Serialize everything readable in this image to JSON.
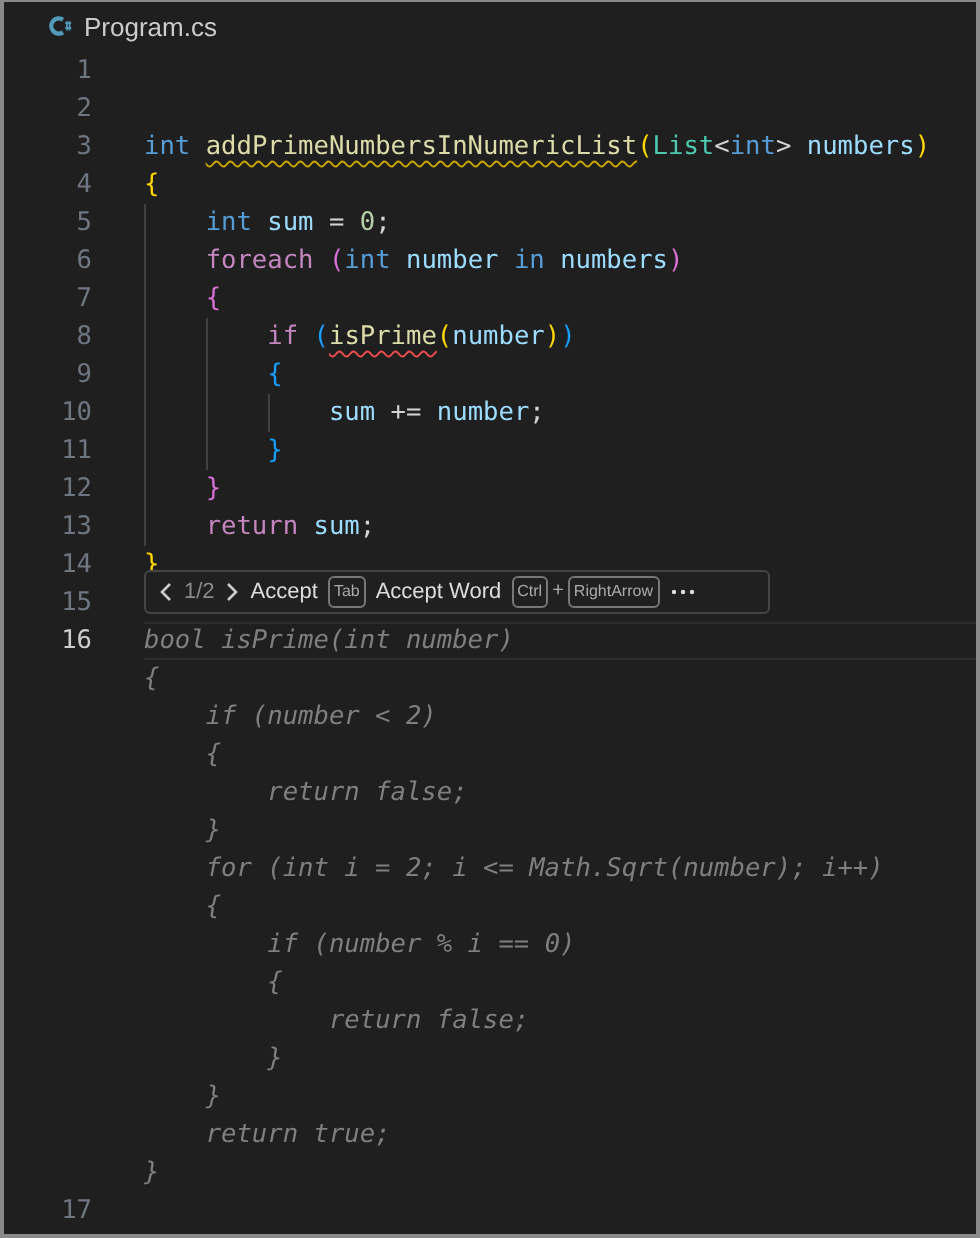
{
  "tab": {
    "title": "Program.cs"
  },
  "lines": [
    {
      "number": "1",
      "current": false
    },
    {
      "number": "2",
      "current": false
    },
    {
      "number": "3",
      "current": false,
      "tokens": [
        {
          "text": "int ",
          "kind": "keyword"
        },
        {
          "text": "addPrimeNumbersInNumericList",
          "kind": "function",
          "warning": true
        },
        {
          "text": "(",
          "kind": "bracket1"
        },
        {
          "text": "List",
          "kind": "type"
        },
        {
          "text": "<",
          "kind": "punct"
        },
        {
          "text": "int",
          "kind": "keyword"
        },
        {
          "text": "> ",
          "kind": "punct"
        },
        {
          "text": "numbers",
          "kind": "variable"
        },
        {
          "text": ")",
          "kind": "bracket1"
        }
      ]
    },
    {
      "number": "4",
      "current": false,
      "tokens": [
        {
          "text": "{",
          "kind": "bracket1"
        }
      ]
    },
    {
      "number": "5",
      "current": false,
      "tokens": [
        {
          "text": "    int ",
          "kind": "keyword"
        },
        {
          "text": "sum",
          "kind": "variable"
        },
        {
          "text": " = ",
          "kind": "punct"
        },
        {
          "text": "0",
          "kind": "number"
        },
        {
          "text": ";",
          "kind": "punct"
        }
      ]
    },
    {
      "number": "6",
      "current": false,
      "tokens": [
        {
          "text": "    foreach ",
          "kind": "control"
        },
        {
          "text": "(",
          "kind": "bracket2"
        },
        {
          "text": "int ",
          "kind": "keyword"
        },
        {
          "text": "number ",
          "kind": "variable"
        },
        {
          "text": "in ",
          "kind": "keyword"
        },
        {
          "text": "numbers",
          "kind": "variable"
        },
        {
          "text": ")",
          "kind": "bracket2"
        }
      ]
    },
    {
      "number": "7",
      "current": false,
      "tokens": [
        {
          "text": "    {",
          "kind": "bracket2"
        }
      ]
    },
    {
      "number": "8",
      "current": false,
      "tokens": [
        {
          "text": "        if ",
          "kind": "control"
        },
        {
          "text": "(",
          "kind": "bracket3"
        },
        {
          "text": "isPrime",
          "kind": "function",
          "error": true
        },
        {
          "text": "(",
          "kind": "bracket1"
        },
        {
          "text": "number",
          "kind": "variable"
        },
        {
          "text": ")",
          "kind": "bracket1"
        },
        {
          "text": ")",
          "kind": "bracket3"
        }
      ]
    },
    {
      "number": "9",
      "current": false,
      "tokens": [
        {
          "text": "        {",
          "kind": "bracket3"
        }
      ]
    },
    {
      "number": "10",
      "current": false,
      "tokens": [
        {
          "text": "            sum",
          "kind": "variable"
        },
        {
          "text": " += ",
          "kind": "punct"
        },
        {
          "text": "number",
          "kind": "variable"
        },
        {
          "text": ";",
          "kind": "punct"
        }
      ]
    },
    {
      "number": "11",
      "current": false,
      "tokens": [
        {
          "text": "        }",
          "kind": "bracket3"
        }
      ]
    },
    {
      "number": "12",
      "current": false,
      "tokens": [
        {
          "text": "    }",
          "kind": "bracket2"
        }
      ]
    },
    {
      "number": "13",
      "current": false,
      "tokens": [
        {
          "text": "    return ",
          "kind": "control"
        },
        {
          "text": "sum",
          "kind": "variable"
        },
        {
          "text": ";",
          "kind": "punct"
        }
      ]
    },
    {
      "number": "14",
      "current": false,
      "tokens": [
        {
          "text": "}",
          "kind": "bracket1"
        }
      ]
    },
    {
      "number": "15",
      "current": false
    },
    {
      "number": "16",
      "current": true,
      "ghost": [
        "bool isPrime(int number)",
        "{",
        "    if (number < 2)",
        "    {",
        "        return false;",
        "    }",
        "    for (int i = 2; i <= Math.Sqrt(number); i++)",
        "    {",
        "        if (number % i == 0)",
        "        {",
        "            return false;",
        "        }",
        "    }",
        "    return true;",
        "}"
      ]
    },
    {
      "number": "17",
      "current": false
    }
  ],
  "suggestion_widget": {
    "counter": "1/2",
    "accept": "Accept",
    "accept_key": "Tab",
    "accept_word": "Accept Word",
    "accept_word_keys": [
      "Ctrl",
      "RightArrow"
    ],
    "plus": "+"
  }
}
